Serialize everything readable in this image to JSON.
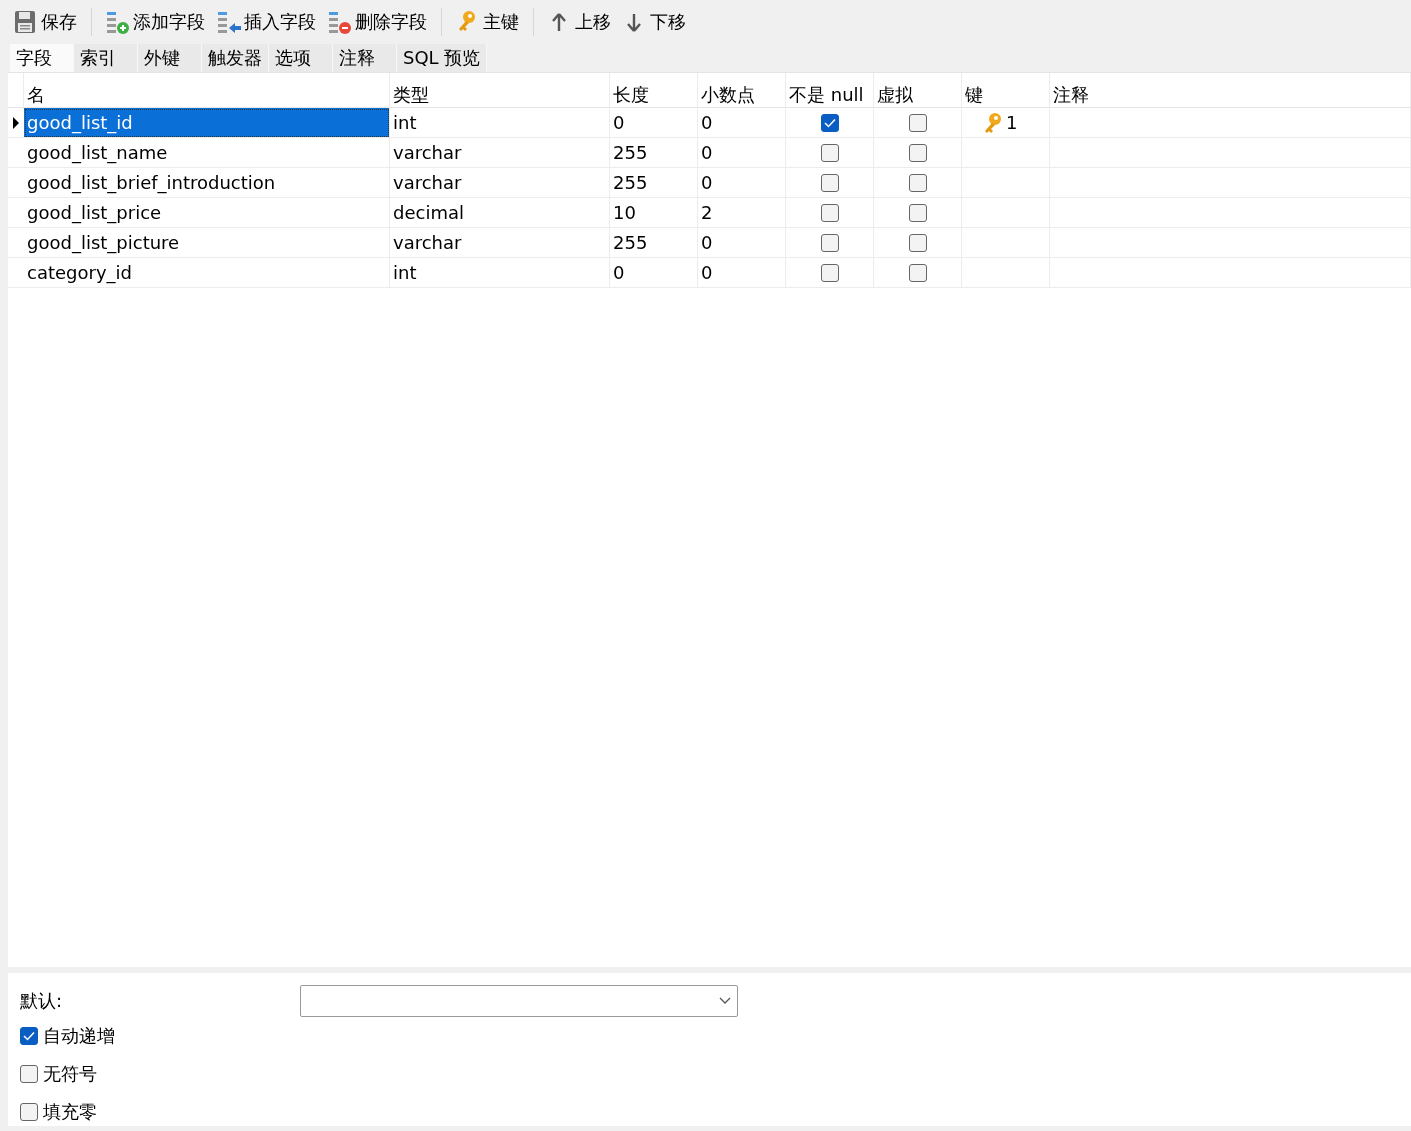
{
  "toolbar": [
    {
      "kind": "save",
      "label": "保存"
    },
    {
      "kind": "add",
      "label": "添加字段"
    },
    {
      "kind": "insert",
      "label": "插入字段"
    },
    {
      "kind": "delete",
      "label": "删除字段"
    },
    {
      "kind": "key",
      "label": "主键"
    },
    {
      "kind": "up",
      "label": "上移"
    },
    {
      "kind": "down",
      "label": "下移"
    }
  ],
  "tabs": [
    {
      "label": "字段",
      "selected": true
    },
    {
      "label": "索引",
      "selected": false
    },
    {
      "label": "外键",
      "selected": false
    },
    {
      "label": "触发器",
      "selected": false
    },
    {
      "label": "选项",
      "selected": false
    },
    {
      "label": "注释",
      "selected": false
    },
    {
      "label": "SQL 预览",
      "selected": false
    }
  ],
  "table": {
    "columns": [
      "名",
      "类型",
      "长度",
      "小数点",
      "不是 null",
      "虚拟",
      "键",
      "注释"
    ],
    "rows": [
      {
        "name": "good_list_id",
        "type": "int",
        "length": "0",
        "decimals": "0",
        "not_null": true,
        "virtual": false,
        "key": "1",
        "selected": true
      },
      {
        "name": "good_list_name",
        "type": "varchar",
        "length": "255",
        "decimals": "0",
        "not_null": false,
        "virtual": false,
        "selected": false
      },
      {
        "name": "good_list_brief_introduction",
        "type": "varchar",
        "length": "255",
        "decimals": "0",
        "not_null": false,
        "virtual": false,
        "selected": false
      },
      {
        "name": "good_list_price",
        "type": "decimal",
        "length": "10",
        "decimals": "2",
        "not_null": false,
        "virtual": false,
        "selected": false
      },
      {
        "name": "good_list_picture",
        "type": "varchar",
        "length": "255",
        "decimals": "0",
        "not_null": false,
        "virtual": false,
        "selected": false
      },
      {
        "name": "category_id",
        "type": "int",
        "length": "0",
        "decimals": "0",
        "not_null": false,
        "virtual": false,
        "selected": false
      }
    ]
  },
  "properties": {
    "default_label": "默认:",
    "options": [
      {
        "label": "自动递增",
        "checked": true
      },
      {
        "label": "无符号",
        "checked": false
      },
      {
        "label": "填充零",
        "checked": false
      }
    ]
  }
}
